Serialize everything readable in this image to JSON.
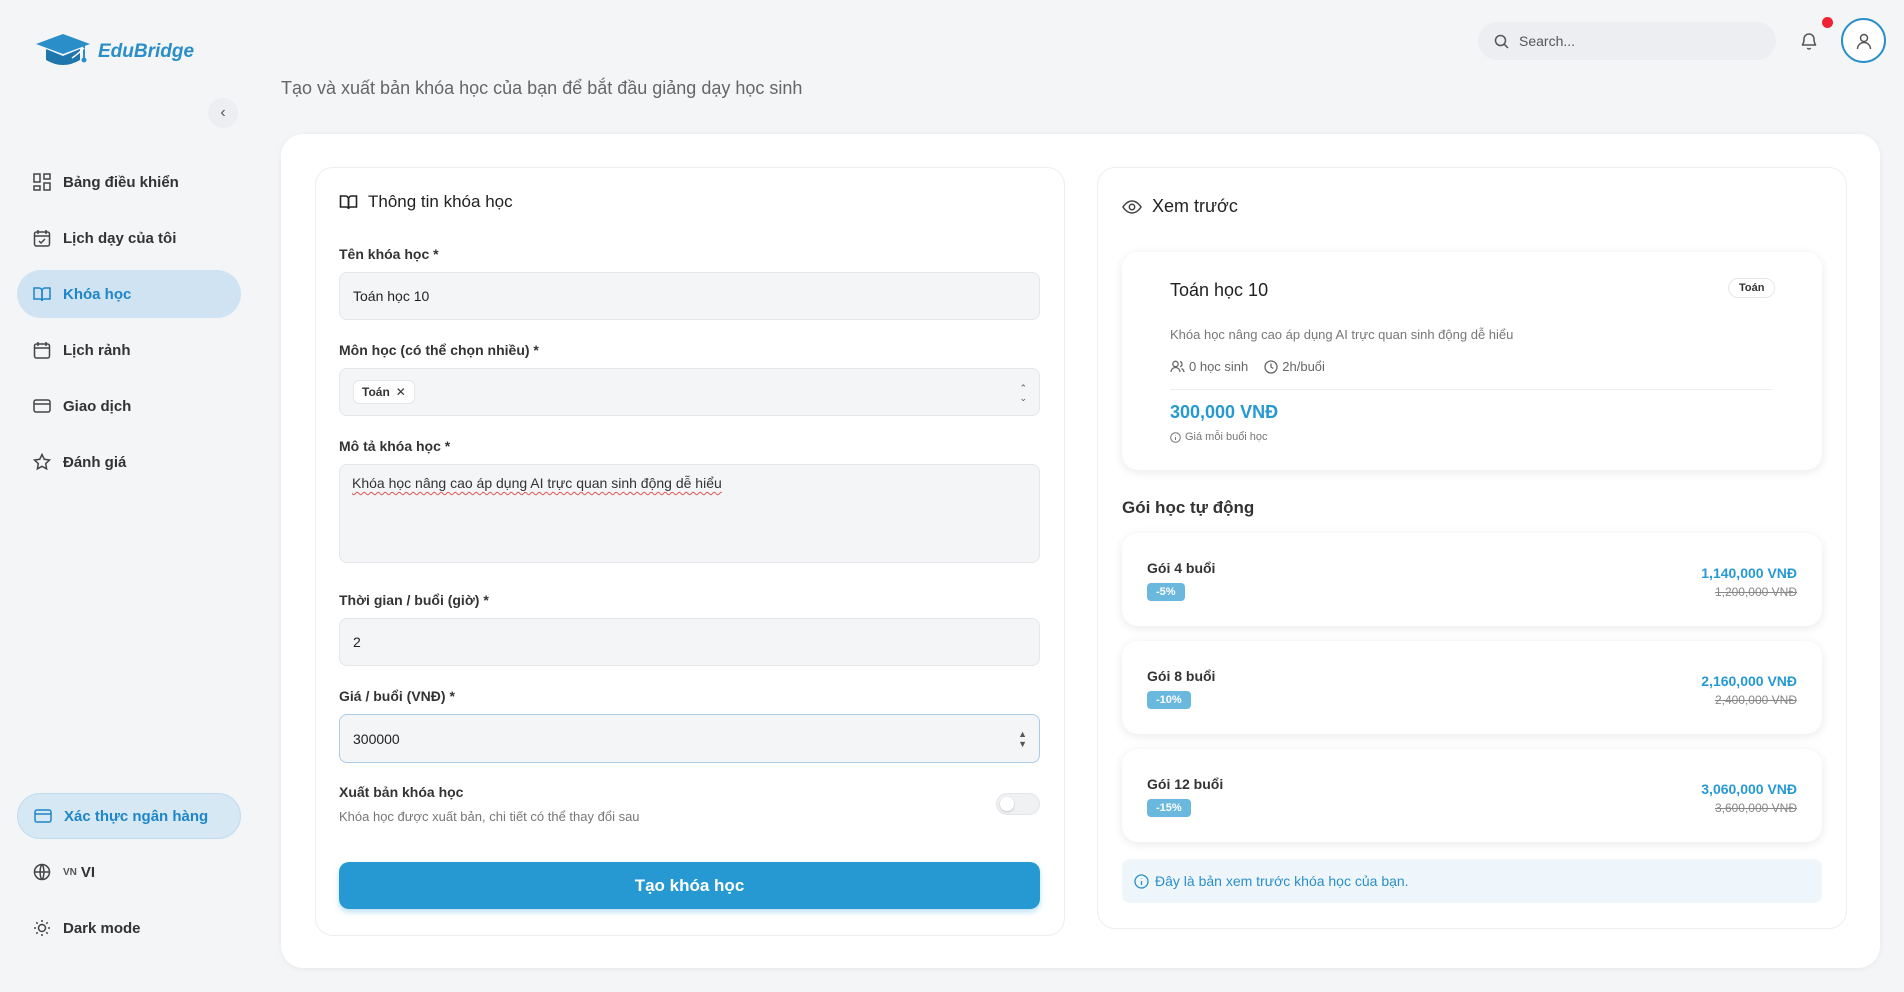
{
  "brand": {
    "name": "EduBridge"
  },
  "header": {
    "search_placeholder": "Search...",
    "subtitle": "Tạo và xuất bản khóa học của bạn để bắt đầu giảng dạy học sinh"
  },
  "sidebar": {
    "items": [
      {
        "label": "Bảng điều khiển",
        "icon": "dashboard-icon",
        "active": false
      },
      {
        "label": "Lịch dạy của tôi",
        "icon": "calendar-check-icon",
        "active": false
      },
      {
        "label": "Khóa học",
        "icon": "book-icon",
        "active": true
      },
      {
        "label": "Lịch rảnh",
        "icon": "calendar-icon",
        "active": false
      },
      {
        "label": "Giao dịch",
        "icon": "credit-card-icon",
        "active": false
      },
      {
        "label": "Đánh giá",
        "icon": "star-icon",
        "active": false
      }
    ],
    "bank_verify": "Xác thực ngân hàng",
    "language_flag": "VN",
    "language": "VI",
    "dark_mode": "Dark mode"
  },
  "form": {
    "title": "Thông tin khóa học",
    "name_label": "Tên khóa học *",
    "name_value": "Toán học 10",
    "subject_label": "Môn học (có thể chọn nhiều) *",
    "subject_chip": "Toán",
    "desc_label": "Mô tả khóa học *",
    "desc_value": "Khóa học nâng cao áp dụng AI trực quan sinh động dễ hiểu",
    "duration_label": "Thời gian / buổi (giờ) *",
    "duration_value": "2",
    "price_label": "Giá / buổi (VNĐ) *",
    "price_value": "300000",
    "publish_label": "Xuất bản khóa học",
    "publish_desc": "Khóa học được xuất bản, chi tiết có thể thay đổi sau",
    "submit": "Tạo khóa học"
  },
  "preview": {
    "title": "Xem trước",
    "course_title": "Toán học 10",
    "badge": "Toán",
    "desc": "Khóa học nâng cao áp dụng AI trực quan sinh động dễ hiểu",
    "students": "0 học sinh",
    "duration": "2h/buổi",
    "price": "300,000 VNĐ",
    "price_note": "Giá mỗi buổi học",
    "auto_title": "Gói học tự động",
    "packages": [
      {
        "name": "Gói 4 buổi",
        "discount": "-5%",
        "price": "1,140,000 VNĐ",
        "old_price": "1,200,000 VNĐ"
      },
      {
        "name": "Gói 8 buổi",
        "discount": "-10%",
        "price": "2,160,000 VNĐ",
        "old_price": "2,400,000 VNĐ"
      },
      {
        "name": "Gói 12 buổi",
        "discount": "-15%",
        "price": "3,060,000 VNĐ",
        "old_price": "3,600,000 VNĐ"
      }
    ],
    "info": "Đây là bản xem trước khóa học của bạn."
  },
  "colors": {
    "accent": "#2699d3",
    "active_nav_bg": "#cfe3f2",
    "notification": "#ee2233"
  }
}
